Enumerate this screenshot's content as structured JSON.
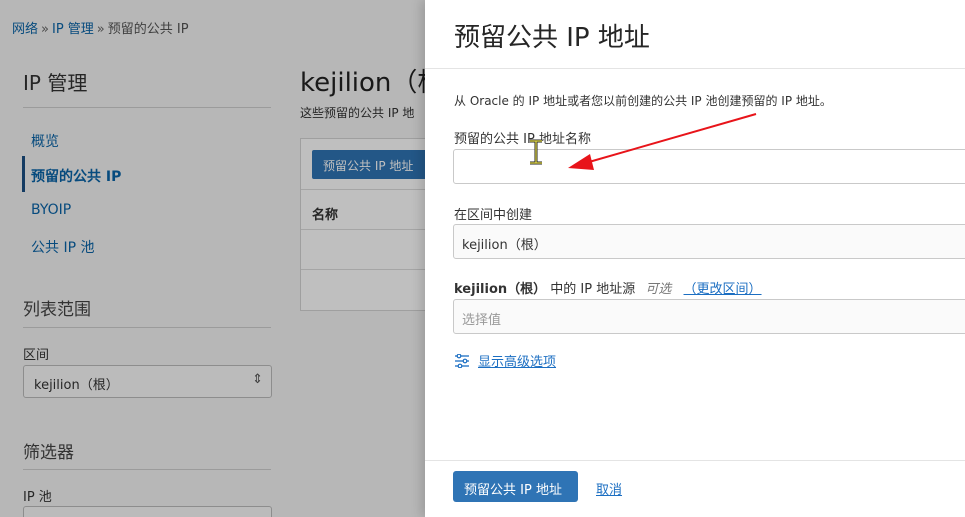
{
  "breadcrumb": {
    "items": [
      "网络",
      "IP 管理",
      "预留的公共 IP"
    ],
    "separator": "»"
  },
  "sidebar": {
    "title": "IP 管理",
    "items": [
      {
        "label": "概览",
        "active": false
      },
      {
        "label": "预留的公共 IP",
        "active": true
      },
      {
        "label": "BYOIP",
        "active": false
      },
      {
        "label": "公共 IP 池",
        "active": false
      }
    ],
    "scope": {
      "heading": "列表范围",
      "compartment_label": "区间",
      "compartment_value": "kejilion（根）"
    },
    "filters": {
      "heading": "筛选器",
      "pool_label": "IP 池"
    }
  },
  "main": {
    "title": "kejilion（根",
    "description": "这些预留的公共 IP 地",
    "create_button": "预留公共 IP 地址",
    "column_name": "名称"
  },
  "panel": {
    "title": "预留公共 IP 地址",
    "intro": "从 Oracle 的 IP 地址或者您以前创建的公共 IP 池创建预留的 IP 地址。",
    "name_field": {
      "label": "预留的公共 IP 地址名称",
      "value": ""
    },
    "compartment_field": {
      "label": "在区间中创建",
      "value": "kejilion（根）"
    },
    "source_field": {
      "label_bold": "kejilion（根）",
      "label_rest": "中的 IP 地址源",
      "optional": "可选",
      "change_link": "（更改区间）",
      "placeholder": "选择值"
    },
    "advanced_link": "显示高级选项",
    "submit_button": "预留公共 IP 地址",
    "cancel_link": "取消"
  },
  "colors": {
    "primary": "#2f74b5",
    "link": "#1b6ec2",
    "annotation_arrow": "#e8141a"
  }
}
